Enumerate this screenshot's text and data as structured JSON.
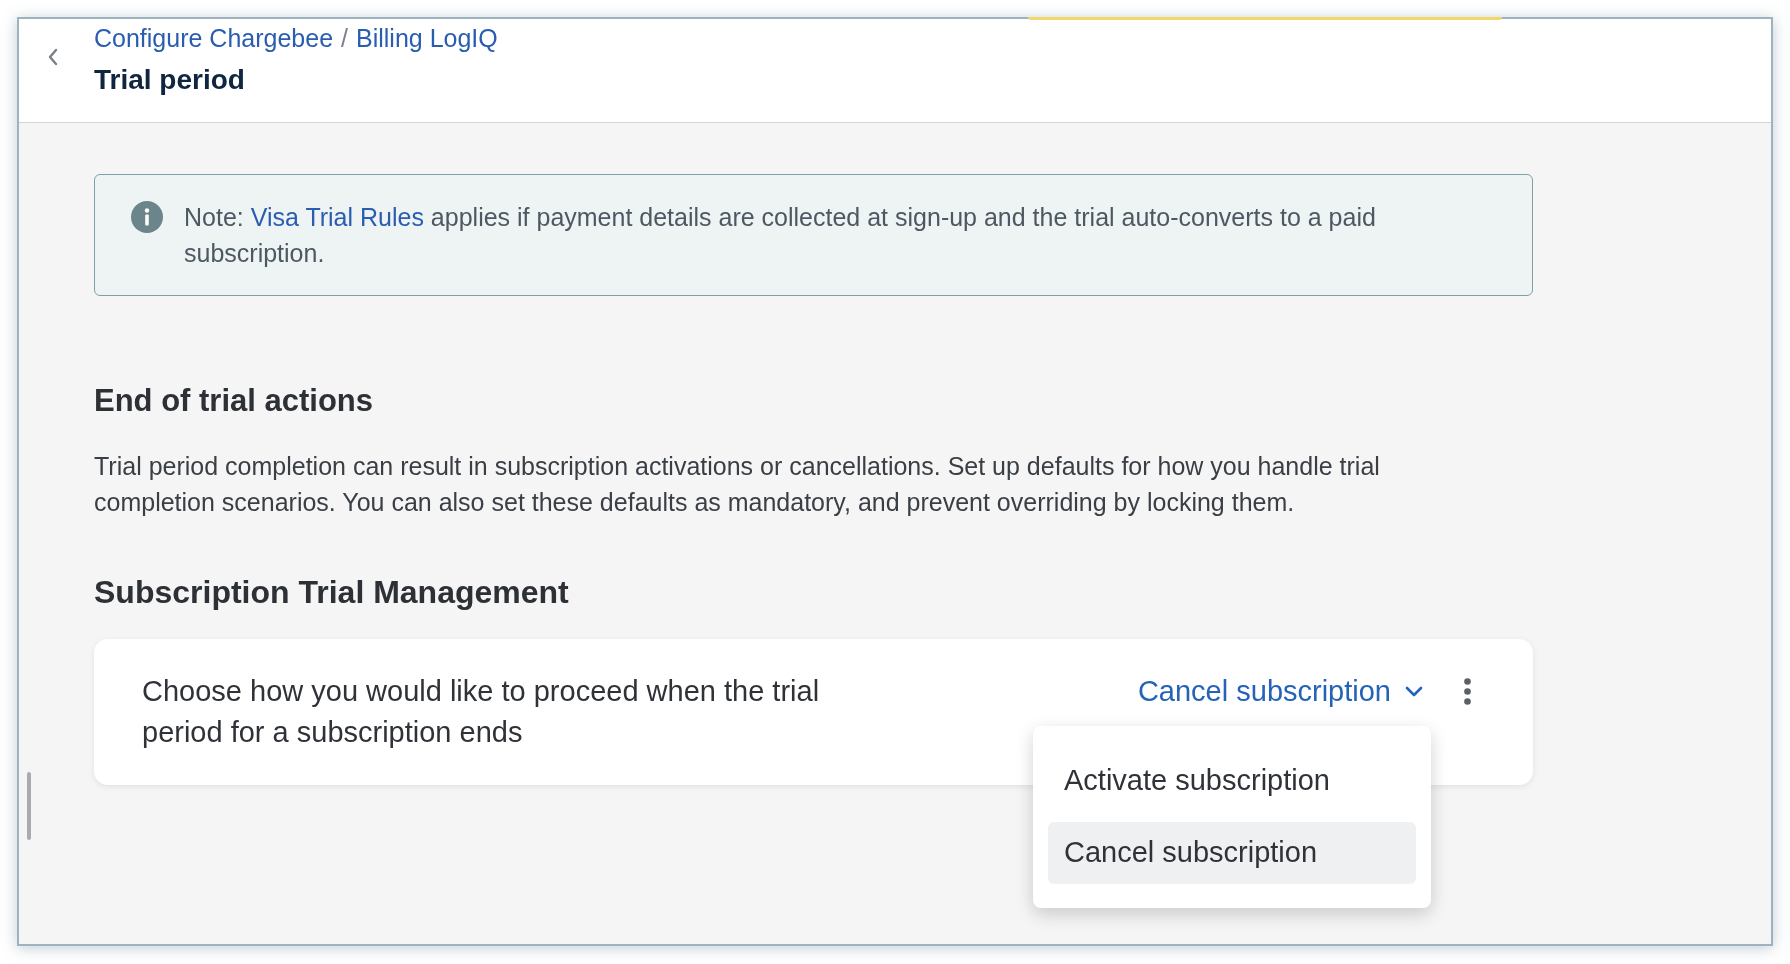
{
  "header": {
    "breadcrumb": [
      {
        "label": "Configure Chargebee"
      },
      {
        "label": "Billing LogIQ"
      }
    ],
    "separator": "/",
    "title": "Trial period"
  },
  "note": {
    "label": "Note:",
    "link": "Visa Trial Rules",
    "text": "applies if payment details are collected at sign-up and the trial auto-converts to a paid subscription."
  },
  "end_of_trial": {
    "heading": "End of trial actions",
    "description": "Trial period completion can result in subscription activations or cancellations. Set up defaults for how you handle trial completion scenarios. You can also set these defaults as mandatory, and prevent overriding by locking them."
  },
  "subscription_trial_management": {
    "heading": "Subscription Trial Management",
    "setting": {
      "description": "Choose how you would like to proceed when the trial period for a subscription ends",
      "dropdown": {
        "value": "Cancel subscription",
        "expanded": true,
        "options": [
          {
            "label": "Activate subscription",
            "selected": false
          },
          {
            "label": "Cancel subscription",
            "selected": true
          }
        ]
      }
    }
  }
}
